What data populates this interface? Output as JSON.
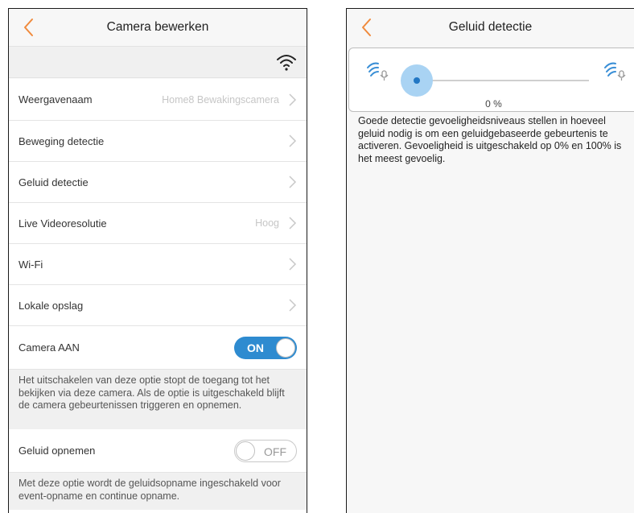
{
  "left": {
    "header": {
      "title": "Camera bewerken"
    },
    "rows": [
      {
        "label": "Weergavenaam",
        "value": "Home8 Bewakingscamera"
      },
      {
        "label": "Beweging detectie",
        "value": ""
      },
      {
        "label": "Geluid detectie",
        "value": ""
      },
      {
        "label": "Live Videoresolutie",
        "value": "Hoog"
      },
      {
        "label": "Wi-Fi",
        "value": ""
      },
      {
        "label": "Lokale opslag",
        "value": ""
      }
    ],
    "camera_on": {
      "label": "Camera AAN",
      "toggle": "ON",
      "note": "Het uitschakelen van deze optie stopt de toegang tot het bekijken via deze camera. Als de optie is uitgeschakeld blijft de camera gebeurtenissen triggeren en opnemen."
    },
    "sound_record": {
      "label": "Geluid opnemen",
      "toggle": "OFF",
      "note": "Met deze optie wordt de geluidsopname ingeschakeld voor event-opname en continue opname."
    }
  },
  "right": {
    "header": {
      "title": "Geluid detectie"
    },
    "slider": {
      "value": 0,
      "value_label": "0 %"
    },
    "description": "Goede detectie gevoeligheidsniveaus stellen in hoeveel geluid nodig is om een geluidgebaseerde gebeurtenis te activeren. Gevoeligheid is uitgeschakeld op 0% en 100% is het meest gevoelig."
  },
  "colors": {
    "accent_orange": "#f08a3c",
    "toggle_blue": "#2e8bd0",
    "slider_halo": "#a9d3f3",
    "slider_dot": "#2277c4",
    "icon_blue": "#3a8fd6"
  },
  "icons": {
    "back": "chevron-left-icon",
    "wifi": "wifi-icon",
    "row_chevron": "chevron-right-icon",
    "sound_low": "sound-mic-low-icon",
    "sound_high": "sound-mic-high-icon"
  }
}
